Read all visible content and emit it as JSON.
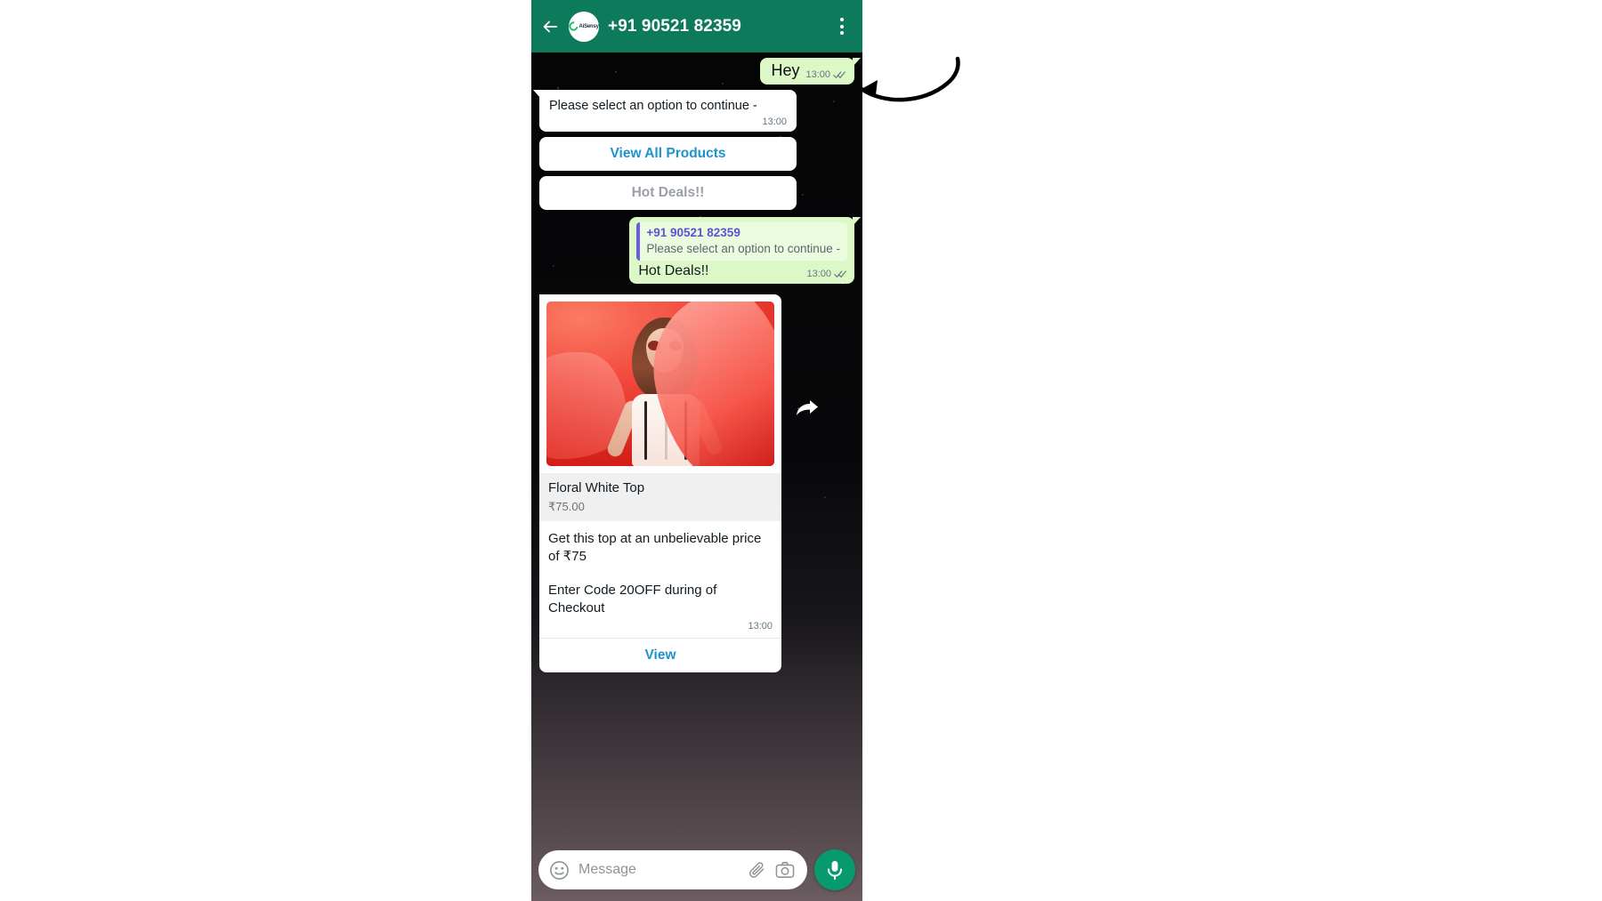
{
  "header": {
    "title": "+91 90521 82359",
    "back_icon": "back-arrow-icon",
    "menu_icon": "kebab-menu-icon",
    "avatar_brand": "AiSensy",
    "bg_color": "#0c7a5b"
  },
  "messages": [
    {
      "id": "hey",
      "direction": "outgoing",
      "text": "Hey",
      "time": "13:00",
      "status": "read"
    },
    {
      "id": "option-prompt",
      "direction": "incoming",
      "text": "Please select an option to continue -",
      "time": "13:00",
      "options": [
        {
          "label": "View All Products",
          "style": "primary"
        },
        {
          "label": "Hot Deals!!",
          "style": "muted"
        }
      ]
    },
    {
      "id": "hot-deals-reply",
      "direction": "outgoing",
      "quote_name": "+91 90521 82359",
      "quote_text": "Please select an option to continue -",
      "text": "Hot Deals!!",
      "time": "13:00",
      "status": "read"
    },
    {
      "id": "product-card",
      "direction": "incoming",
      "product_title": "Floral White Top",
      "product_price": "₹75.00",
      "description_line1": "Get this top at an unbelievable price of ₹75",
      "description_line2": "Enter Code 20OFF during of Checkout",
      "time": "13:00",
      "cta_label": "View",
      "forward_icon": "forward-arrow-icon"
    }
  ],
  "footer": {
    "placeholder": "Message",
    "emoji_icon": "emoji-smiley-icon",
    "attach_icon": "paperclip-icon",
    "camera_icon": "camera-icon",
    "mic_icon": "microphone-icon",
    "mic_bg": "#079a6e"
  },
  "annotation": {
    "name": "curved-pointer-arrow"
  },
  "colors": {
    "header_green": "#0c7a5b",
    "outgoing_bubble": "#dcf8c6",
    "incoming_bubble": "#ffffff",
    "link_blue": "#1d93cf",
    "quote_accent": "#6b5ce7",
    "muted_text": "#9aa0a6"
  }
}
